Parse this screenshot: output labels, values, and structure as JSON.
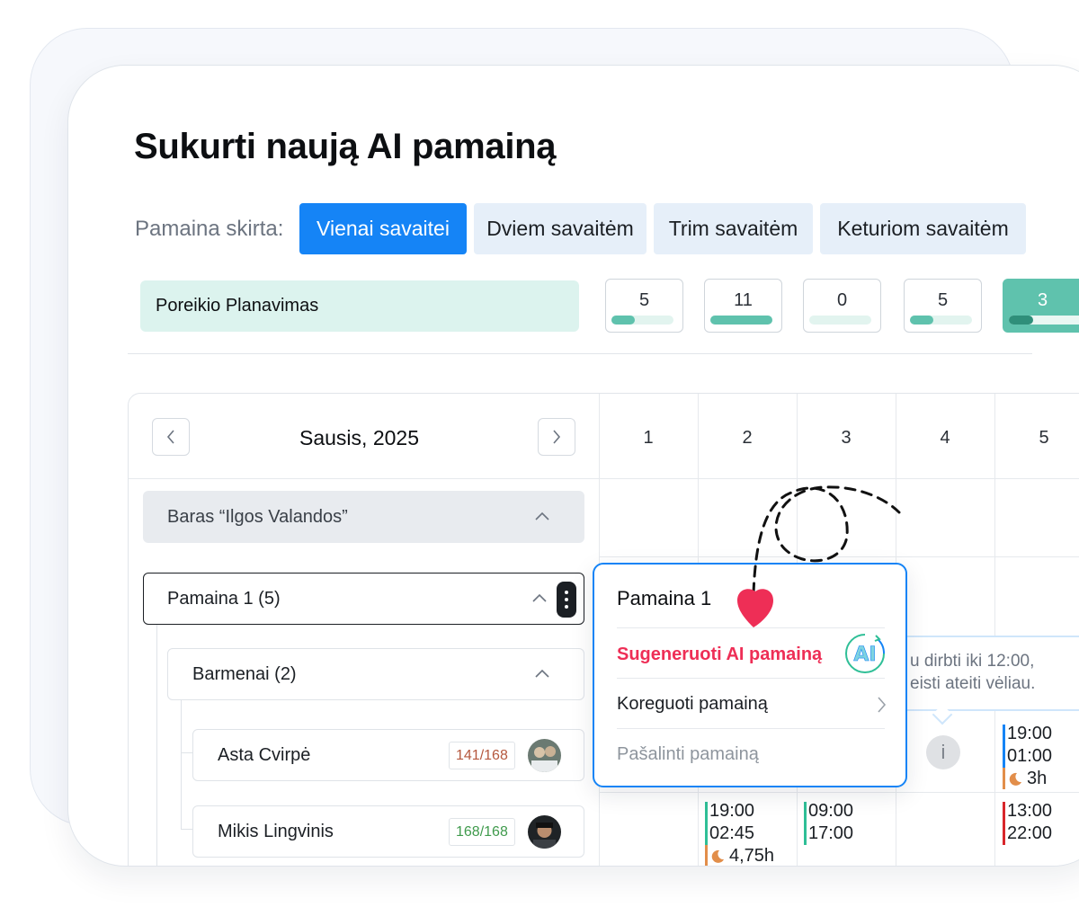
{
  "title": "Sukurti naują AI pamainą",
  "period": {
    "label": "Pamaina skirta:",
    "options": [
      "Vienai savaitei",
      "Dviem savaitėm",
      "Trim savaitėm",
      "Keturiom savaitėm"
    ],
    "selected": "Vienai savaitei"
  },
  "demand": {
    "label": "Poreikio Planavimas",
    "counts": [
      {
        "value": "5",
        "fill": 0.38
      },
      {
        "value": "11",
        "fill": 1.0
      },
      {
        "value": "0",
        "fill": 0.0
      },
      {
        "value": "5",
        "fill": 0.38
      },
      {
        "value": "3",
        "fill": 0.22
      }
    ]
  },
  "calendar": {
    "month": "Sausis, 2025",
    "days": [
      "1",
      "2",
      "3",
      "4",
      "5"
    ]
  },
  "tree": {
    "group": "Baras “Ilgos Valandos”",
    "shift": "Pamaina 1 (5)",
    "role": "Barmenai (2)",
    "employees": [
      {
        "name": "Asta Cvirpė",
        "hours": "141/168",
        "hours_color": "#b5583e"
      },
      {
        "name": "Mikis Lingvinis",
        "hours": "168/168",
        "hours_color": "#3f9a4c"
      }
    ]
  },
  "shifts": {
    "row1_day5": {
      "start": "19:00",
      "end": "01:00",
      "break": "3h",
      "color": "#1584f6"
    },
    "row2_day2": {
      "start": "19:00",
      "end": "02:45",
      "break": "4,75h",
      "color": "#2fbf97"
    },
    "row2_day3": {
      "start": "09:00",
      "end": "17:00",
      "color": "#2fbf97"
    },
    "row2_day5": {
      "start": "13:00",
      "end": "22:00",
      "color": "#d8262b"
    }
  },
  "tooltip": {
    "line1": "u dirbti iki 12:00,",
    "line2": "eisti ateiti vėliau.",
    "info_icon": "i"
  },
  "popup": {
    "title": "Pamaina 1",
    "ai_action": "Sugeneruoti AI pamainą",
    "ai_badge": "AI",
    "edit_action": "Koreguoti pamainą",
    "remove_action": "Pašalinti pamainą"
  },
  "colors": {
    "primary": "#1584f6",
    "accent_teal": "#5fc2ad",
    "ai_red": "#ee2e56",
    "break_orange": "#e28e4a"
  }
}
